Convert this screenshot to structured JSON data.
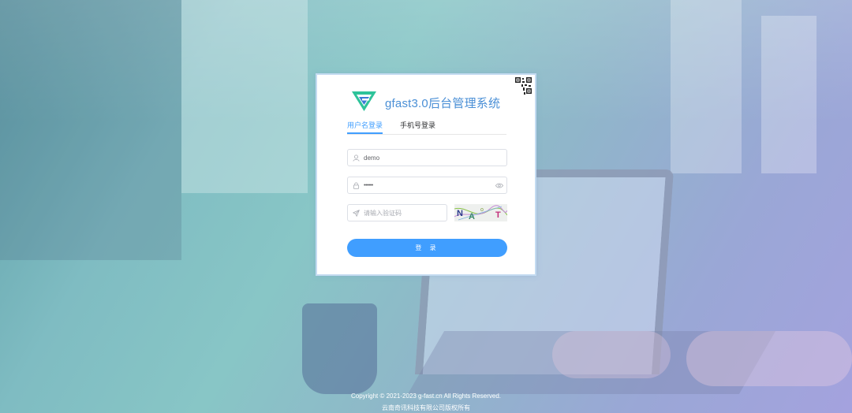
{
  "app": {
    "title": "gfast3.0后台管理系统"
  },
  "tabs": [
    {
      "label": "用户名登录",
      "active": true
    },
    {
      "label": "手机号登录",
      "active": false
    }
  ],
  "form": {
    "username_value": "demo",
    "password_value": "••••••",
    "captcha_placeholder": "请输入验证码",
    "captcha_image_text": "NA T"
  },
  "login_button": {
    "label": "登 录"
  },
  "footer": {
    "copyright": "Copyright © 2021-2023 g-fast.cn All Rights Reserved.",
    "company": "云南奇讯科技有限公司版权所有"
  },
  "colors": {
    "primary": "#409eff",
    "brand_text": "#4a8fd6",
    "logo_green": "#2ec39a",
    "logo_blue": "#3a7ad6"
  },
  "icons": {
    "user": "user-icon",
    "lock": "lock-icon",
    "eye": "eye-icon",
    "captcha": "send-icon",
    "qr": "qr-code-icon"
  }
}
